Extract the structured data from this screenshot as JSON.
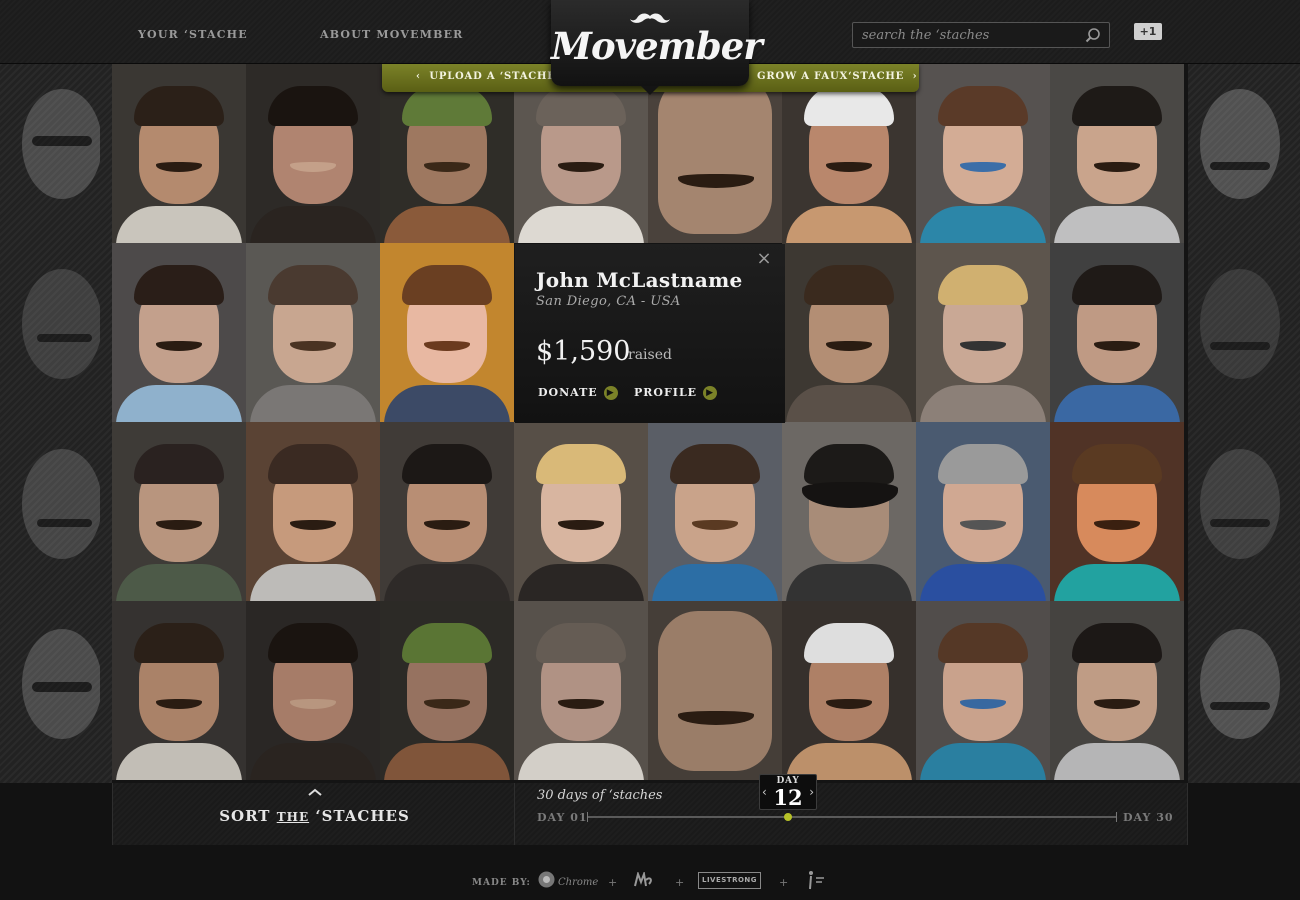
{
  "header": {
    "nav": [
      "YOUR ‘STACHE",
      "ABOUT MOVEMBER"
    ],
    "logo": "Movember",
    "search_placeholder": "search the ‘staches",
    "plus_one": "+1",
    "ribbon_left": "UPLOAD A ‘STACHE",
    "ribbon_right": "GROW A FAUX‘STACHE"
  },
  "profile_popup": {
    "name": "John McLastname",
    "location": "San Diego, CA - USA",
    "amount": "$1,590",
    "amount_suffix": "raised",
    "donate_label": "DONATE",
    "profile_label": "PROFILE"
  },
  "sort": {
    "label_pre": "SORT",
    "label_the": "THE",
    "label_post": "‘STACHES"
  },
  "timeline": {
    "caption": "30 days of ‘staches",
    "start_label": "DAY 01",
    "end_label": "DAY 30",
    "day_label": "DAY",
    "current_day": "12",
    "current_day_value": 12,
    "total_days": 30
  },
  "footer": {
    "made_by": "MADE BY:",
    "partners": [
      "Chrome"
    ],
    "livestrong": "LIVESTRONG",
    "separator": "+"
  },
  "colors": {
    "accent_green": "#7b8228",
    "knob_green": "#b7c228"
  }
}
